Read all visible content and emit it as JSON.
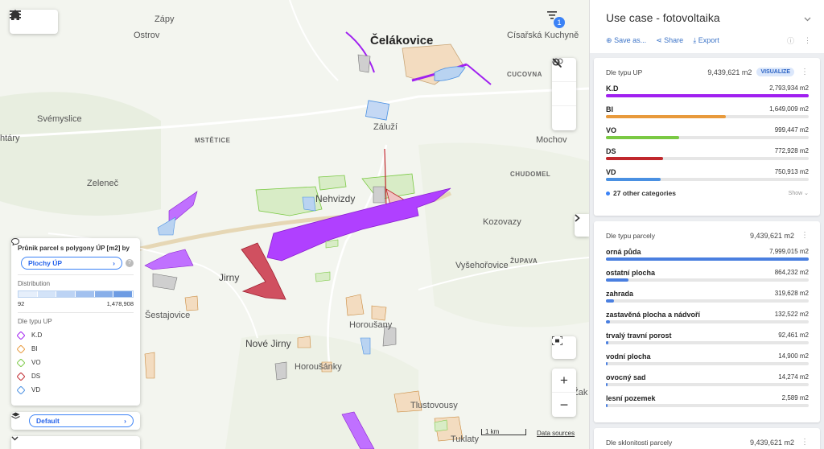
{
  "map": {
    "places": [
      {
        "id": "zapy",
        "label": "Zápy"
      },
      {
        "id": "ostrov",
        "label": "Ostrov"
      },
      {
        "id": "celakovice",
        "label": "Čelákovice"
      },
      {
        "id": "cisarska",
        "label": "Císařská Kuchyně"
      },
      {
        "id": "cucovna",
        "label": "CUCOVNA"
      },
      {
        "id": "svemyslice",
        "label": "Svémyslice"
      },
      {
        "id": "zaluzi",
        "label": "Záluží"
      },
      {
        "id": "mochov",
        "label": "Mochov"
      },
      {
        "id": "mstetice",
        "label": "MSTĚTICE"
      },
      {
        "id": "chtary",
        "label": "htáry"
      },
      {
        "id": "chudomel",
        "label": "CHUDOMEL"
      },
      {
        "id": "zelenec",
        "label": "Zeleneč"
      },
      {
        "id": "nehvizdy",
        "label": "Nehvizdy"
      },
      {
        "id": "kozovazy",
        "label": "Kozovazy"
      },
      {
        "id": "vysehorovice",
        "label": "Vyšehořovice"
      },
      {
        "id": "zupava",
        "label": "ŽUPAVA"
      },
      {
        "id": "jirny",
        "label": "Jirny"
      },
      {
        "id": "sestajovice",
        "label": "Šestajovice"
      },
      {
        "id": "horousany1",
        "label": "Horoušany"
      },
      {
        "id": "nove_jirny",
        "label": "Nové Jirny"
      },
      {
        "id": "horousany2",
        "label": "Horoušánky"
      },
      {
        "id": "tlustovousy",
        "label": "Tlustovousy"
      },
      {
        "id": "tuklaty",
        "label": "Tuklaty"
      },
      {
        "id": "zak",
        "label": "Žak"
      }
    ],
    "filter_count": "1",
    "scale_label": "1 km",
    "attribution": "Data sources",
    "legend": {
      "title": "Průnik parcel s polygony ÚP [m2] by",
      "layer_pill": "Plochy ÚP",
      "distribution_label": "Distribution",
      "dist_min": "92",
      "dist_max": "1,478,908",
      "categories_label": "Dle typu UP",
      "items": [
        {
          "label": "K.D",
          "color": "#a020f0"
        },
        {
          "label": "BI",
          "color": "#e89a3c"
        },
        {
          "label": "VO",
          "color": "#7ac943"
        },
        {
          "label": "DS",
          "color": "#c0282d"
        },
        {
          "label": "VD",
          "color": "#4a90e2"
        }
      ]
    },
    "style_pill": "Default"
  },
  "panel": {
    "title": "Use case - fotovoltaika",
    "actions": {
      "save": "Save as...",
      "share": "Share",
      "export": "Export"
    },
    "cards": [
      {
        "title": "Dle typu UP",
        "total": "9,439,621 m2",
        "visualize": "VISUALIZE",
        "rows": [
          {
            "name": "K.D",
            "value": "2,793,934 m2",
            "pct": 100,
            "color": "#a020f0"
          },
          {
            "name": "BI",
            "value": "1,649,009 m2",
            "pct": 59,
            "color": "#e89a3c"
          },
          {
            "name": "VO",
            "value": "999,447 m2",
            "pct": 36,
            "color": "#7ac943"
          },
          {
            "name": "DS",
            "value": "772,928 m2",
            "pct": 28,
            "color": "#c0282d"
          },
          {
            "name": "VD",
            "value": "750,913 m2",
            "pct": 27,
            "color": "#4a90e2"
          }
        ],
        "other": "27 other categories",
        "show": "Show"
      },
      {
        "title": "Dle typu parcely",
        "total": "9,439,621 m2",
        "rows": [
          {
            "name": "orná půda",
            "value": "7,999,015 m2",
            "pct": 100,
            "color": "#4a7fe0"
          },
          {
            "name": "ostatní plocha",
            "value": "864,232 m2",
            "pct": 11,
            "color": "#4a7fe0"
          },
          {
            "name": "zahrada",
            "value": "319,628 m2",
            "pct": 4,
            "color": "#4a7fe0"
          },
          {
            "name": "zastavěná plocha a nádvoří",
            "value": "132,522 m2",
            "pct": 2,
            "color": "#4a7fe0"
          },
          {
            "name": "trvalý travní porost",
            "value": "92,461 m2",
            "pct": 1.2,
            "color": "#4a7fe0"
          },
          {
            "name": "vodní plocha",
            "value": "14,900 m2",
            "pct": 0.4,
            "color": "#4a7fe0"
          },
          {
            "name": "ovocný sad",
            "value": "14,274 m2",
            "pct": 0.4,
            "color": "#4a7fe0"
          },
          {
            "name": "lesní pozemek",
            "value": "2,589 m2",
            "pct": 0.2,
            "color": "#4a7fe0"
          }
        ]
      },
      {
        "title": "Dle sklonitosti parcely",
        "total": "9,439,621 m2"
      }
    ]
  }
}
